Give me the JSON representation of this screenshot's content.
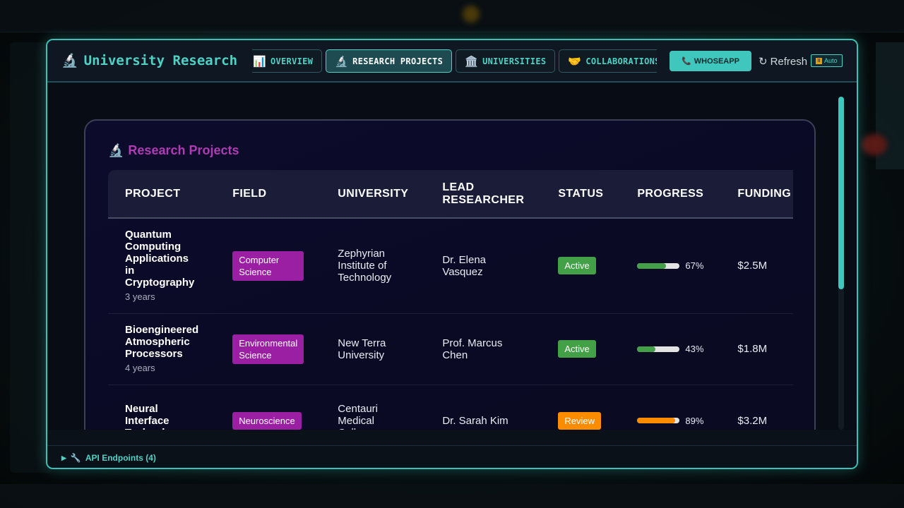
{
  "modal": {
    "title": "University Research",
    "title_icon": "🔬",
    "tabs": [
      {
        "label": "OVERVIEW",
        "icon": "📊"
      },
      {
        "label": "RESEARCH PROJECTS",
        "icon": "🔬"
      },
      {
        "label": "UNIVERSITIES",
        "icon": "🏛️"
      },
      {
        "label": "COLLABORATIONS",
        "icon": "🤝"
      }
    ],
    "active_tab": "RESEARCH PROJECTS",
    "primary_button": {
      "label": "WHOSEAPP",
      "icon": "📞"
    },
    "refresh": {
      "label": "Refresh",
      "icon": "↻"
    },
    "auto_badge": "Auto",
    "footer_toggle": {
      "arrow": "▶",
      "icon": "🔧",
      "label": "API Endpoints (4)"
    }
  },
  "card": {
    "title": "Research Projects",
    "title_icon": "🔬",
    "columns": [
      "PROJECT",
      "FIELD",
      "UNIVERSITY",
      "LEAD RESEARCHER",
      "STATUS",
      "PROGRESS",
      "FUNDING"
    ],
    "rows": [
      {
        "project": "Quantum Computing Applications in Cryptography",
        "duration": "3 years",
        "field": "Computer Science",
        "university": "Zephyrian Institute of Technology",
        "lead": "Dr. Elena Vasquez",
        "status": "Active",
        "status_color": "#43a047",
        "progress": 67,
        "progress_label": "67%",
        "progress_color": "#43a047",
        "funding": "$2.5M"
      },
      {
        "project": "Bioengineered Atmospheric Processors",
        "duration": "4 years",
        "field": "Environmental Science",
        "university": "New Terra University",
        "lead": "Prof. Marcus Chen",
        "status": "Active",
        "status_color": "#43a047",
        "progress": 43,
        "progress_label": "43%",
        "progress_color": "#43a047",
        "funding": "$1.8M"
      },
      {
        "project": "Neural Interface Technology",
        "duration": "",
        "field": "Neuroscience",
        "university": "Centauri Medical College",
        "lead": "Dr. Sarah Kim",
        "status": "Review",
        "status_color": "#fb8c00",
        "progress": 89,
        "progress_label": "89%",
        "progress_color": "#fb8c00",
        "funding": "$3.2M"
      }
    ]
  },
  "colors": {
    "accent": "#4fd1c5",
    "field_badge": "#9a1fa3",
    "card_title": "#b13ab5"
  }
}
